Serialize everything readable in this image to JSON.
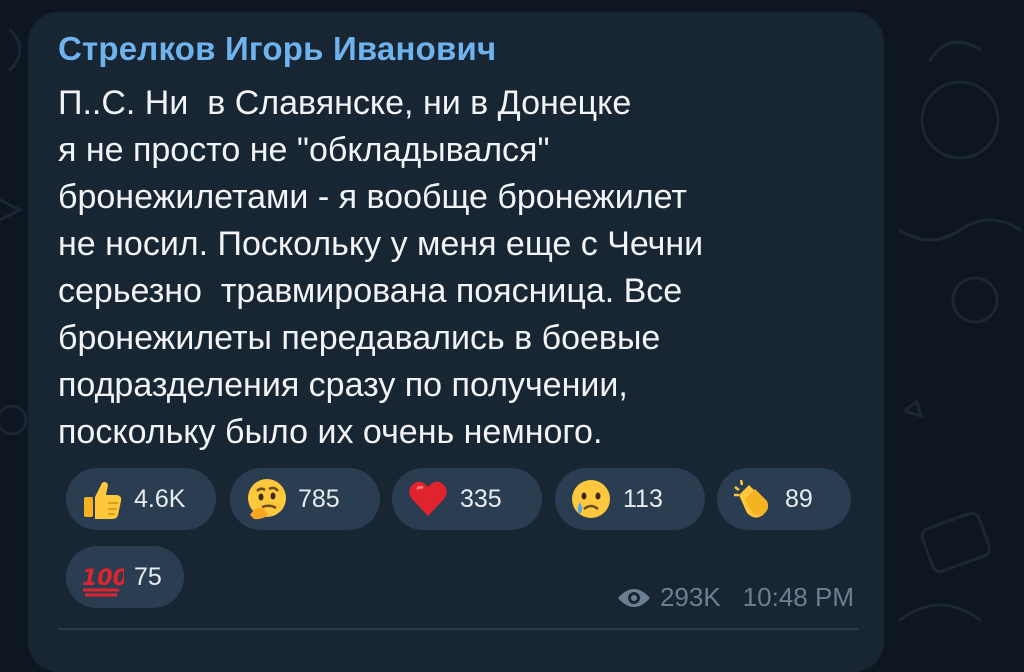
{
  "message": {
    "sender": "Стрелков Игорь Иванович",
    "lines": [
      "П..С. Ни  в Славянске, ни в Донецке",
      "я не просто не \"обкладывался\"",
      "бронежилетами - я вообще бронежилет",
      "не носил. Поскольку у меня еще с Чечни",
      "серьезно  травмирована поясница. Все",
      "бронежилеты передавались в боевые",
      "подразделения сразу по получении,",
      "поскольку было их очень немного."
    ],
    "views": "293K",
    "time": "10:48 PM"
  },
  "reactions": [
    {
      "icon": "thumbs-up-icon",
      "count": "4.6K"
    },
    {
      "icon": "thinking-face-icon",
      "count": "785"
    },
    {
      "icon": "red-heart-icon",
      "count": "335"
    },
    {
      "icon": "crying-face-icon",
      "count": "113"
    },
    {
      "icon": "clapping-hands-icon",
      "count": "89"
    },
    {
      "icon": "hundred-points-icon",
      "count": "75"
    }
  ],
  "colors": {
    "background": "#0e1621",
    "bubble": "#182533",
    "sender": "#6fb3ee",
    "reaction_pill": "#2b3d50"
  }
}
